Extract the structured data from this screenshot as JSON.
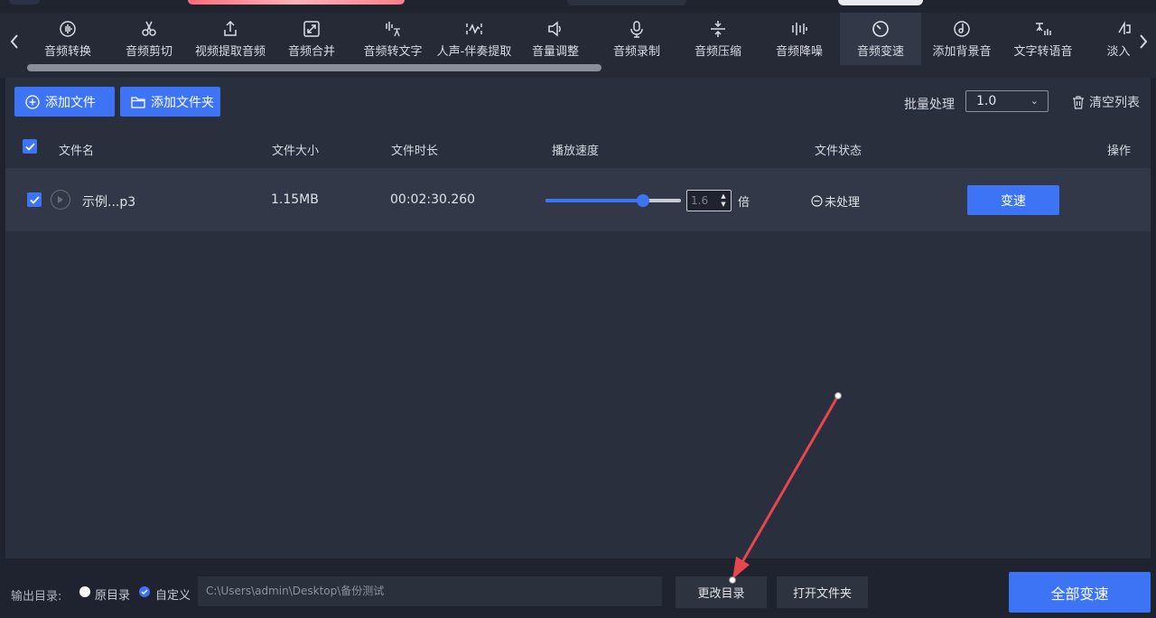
{
  "toolbar": {
    "items": [
      {
        "label": "音频转换",
        "icon": "audio-waveform-icon"
      },
      {
        "label": "音频剪切",
        "icon": "scissors-icon"
      },
      {
        "label": "视频提取音频",
        "icon": "upload-icon"
      },
      {
        "label": "音频合并",
        "icon": "merge-icon"
      },
      {
        "label": "音频转文字",
        "icon": "speech-to-text-icon"
      },
      {
        "label": "人声-伴奏提取",
        "icon": "vocal-separation-icon"
      },
      {
        "label": "音量调整",
        "icon": "volume-icon"
      },
      {
        "label": "音频录制",
        "icon": "microphone-icon"
      },
      {
        "label": "音频压缩",
        "icon": "compress-icon"
      },
      {
        "label": "音频降噪",
        "icon": "noise-reduction-icon"
      },
      {
        "label": "音频变速",
        "icon": "speedometer-icon"
      },
      {
        "label": "添加背景音",
        "icon": "background-music-icon"
      },
      {
        "label": "文字转语音",
        "icon": "text-to-speech-icon"
      },
      {
        "label": "淡入淡",
        "icon": "fade-icon"
      }
    ],
    "active_index": 10
  },
  "actions": {
    "add_file": "添加文件",
    "add_folder": "添加文件夹",
    "batch_label": "批量处理",
    "batch_value": "1.0",
    "clear_list": "清空列表"
  },
  "table": {
    "headers": {
      "name": "文件名",
      "size": "文件大小",
      "duration": "文件时长",
      "speed": "播放速度",
      "status": "文件状态",
      "action": "操作"
    },
    "rows": [
      {
        "name": "示例...p3",
        "size": "1.15MB",
        "duration": "00:02:30.260",
        "speed_value": "1.6",
        "speed_slider_fraction": 0.72,
        "unit": "倍",
        "status": "未处理",
        "action_label": "变速"
      }
    ]
  },
  "bottom": {
    "output_label": "输出目录:",
    "option_original": "原目录",
    "option_custom": "自定义",
    "path": "C:\\Users\\admin\\Desktop\\备份测试",
    "change_dir": "更改目录",
    "open_folder": "打开文件夹",
    "convert_all": "全部变速"
  },
  "colors": {
    "accent": "#3d74f5",
    "annotation_arrow": "#e8464f"
  }
}
